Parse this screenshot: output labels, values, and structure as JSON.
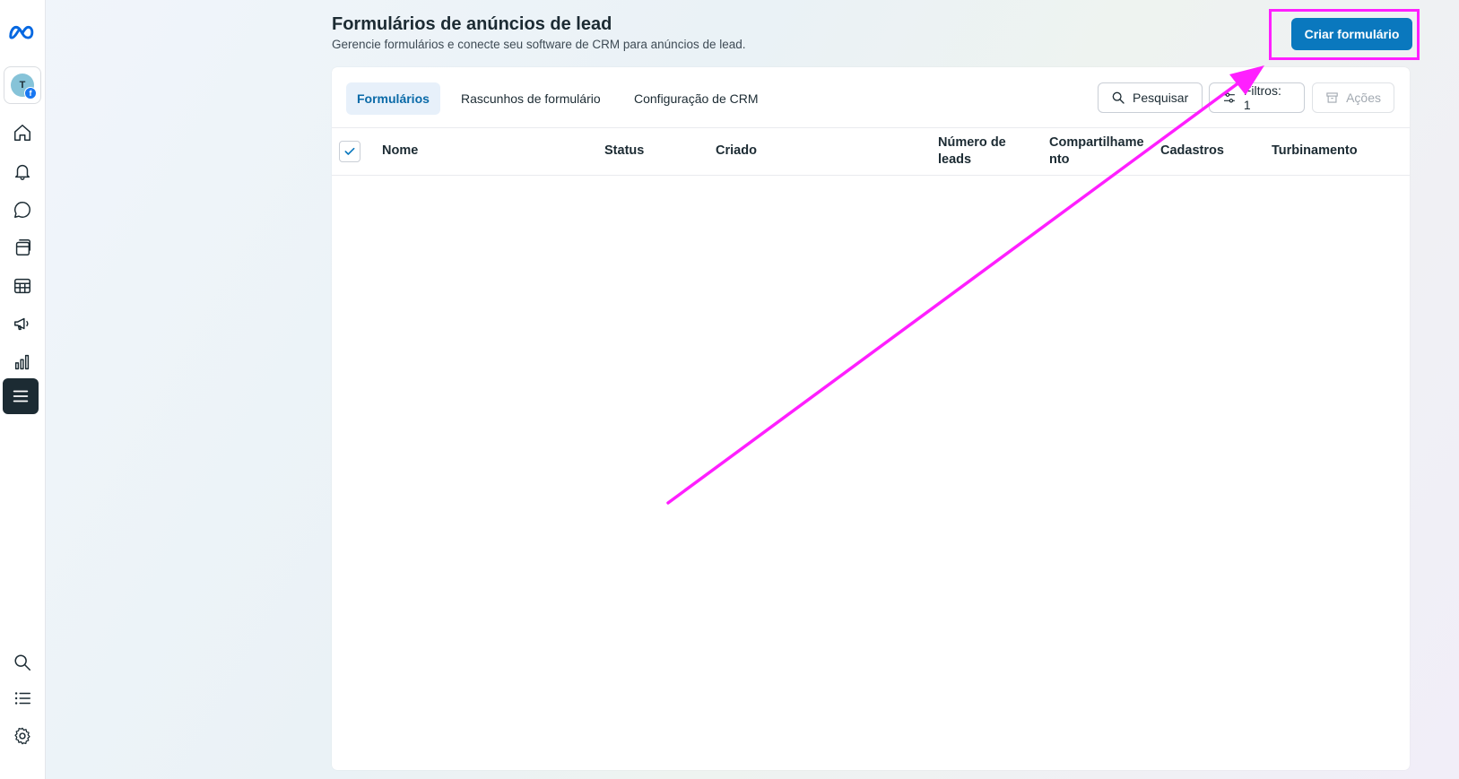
{
  "sidebar": {
    "avatar_initial": "T",
    "icons": [
      "meta-logo-icon",
      "home-icon",
      "bell-icon",
      "chat-icon",
      "pages-icon",
      "table-icon",
      "megaphone-icon",
      "bar-chart-icon",
      "menu-icon",
      "search-icon",
      "list-icon",
      "gear-icon"
    ]
  },
  "header": {
    "title": "Formulários de anúncios de lead",
    "subtitle": "Gerencie formulários e conecte seu software de CRM para anúncios de lead.",
    "create_button": "Criar formulário"
  },
  "tabs": [
    {
      "label": "Formulários",
      "active": true
    },
    {
      "label": "Rascunhos de formulário",
      "active": false
    },
    {
      "label": "Configuração de CRM",
      "active": false
    }
  ],
  "toolbar": {
    "search_label": "Pesquisar",
    "filters_label": "Filtros: 1",
    "actions_label": "Ações"
  },
  "table": {
    "columns": [
      "Nome",
      "Status",
      "Criado",
      "Número de leads",
      "Compartilhamento",
      "Cadastros",
      "Turbinamento"
    ],
    "rows": []
  },
  "colors": {
    "primary": "#0a78be",
    "highlight": "#ff1fff"
  }
}
